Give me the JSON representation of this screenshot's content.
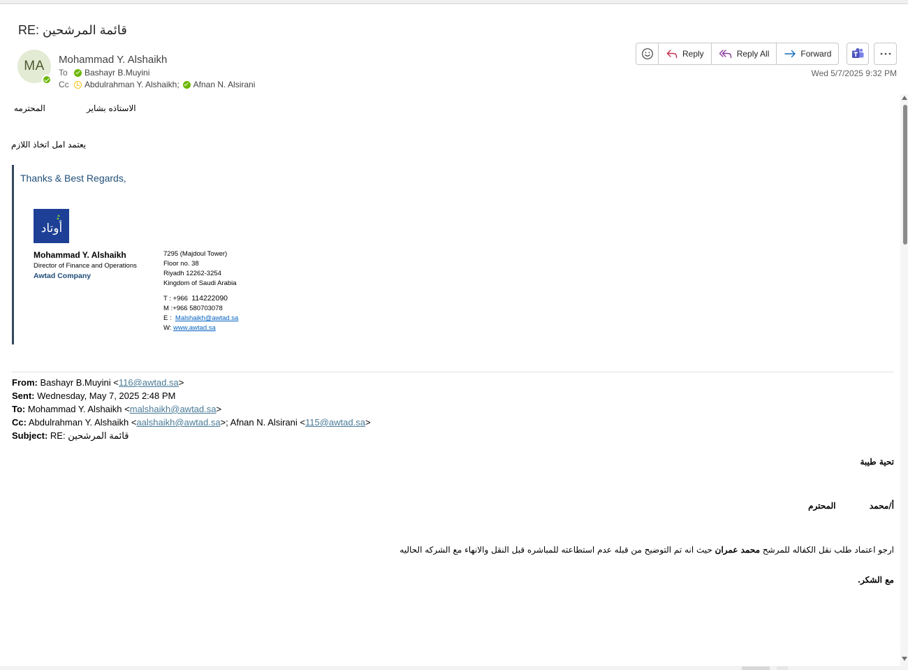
{
  "message": {
    "subject": "RE: قائمة المرشحين",
    "sender": {
      "initials": "MA",
      "name": "Mohammad Y. Alshaikh"
    },
    "to_label": "To",
    "cc_label": "Cc",
    "to": [
      {
        "name": "Bashayr B.Muyini",
        "status": "available"
      }
    ],
    "cc": [
      {
        "name": "Abdulrahman Y. Alshaikh;",
        "status": "away"
      },
      {
        "name": "Afnan N. Alsirani",
        "status": "available"
      }
    ],
    "date": "Wed 5/7/2025 9:32 PM"
  },
  "actions": {
    "reply": "Reply",
    "reply_all": "Reply All",
    "forward": "Forward"
  },
  "icons": {
    "emoji": "emoji-icon",
    "reply": "reply-arrow-icon",
    "reply_all": "reply-all-arrow-icon",
    "forward": "forward-arrow-icon",
    "teams": "teams-icon",
    "more": "more-dots-icon"
  },
  "colors": {
    "accent": "#0f6cbd",
    "reply_icon": "#c4314b",
    "reply_all_icon": "#8b3a9b",
    "forward_icon": "#0f6cbd",
    "teams": "#5b5fc7",
    "presence_available": "#6bb700",
    "presence_away": "#f8c01d",
    "signature_blue": "#1f4e79",
    "logo_bg": "#1d3f95"
  },
  "reply": {
    "greeting_title": "الاستاذه بشاير",
    "greeting_honorific": "المحترمه",
    "body": "يعتمد امل اتخاذ اللازم"
  },
  "signature": {
    "thanks": "Thanks & Best Regards,",
    "logo_text": "أوتاد",
    "name": "Mohammad Y. Alshaikh",
    "title": "Director of Finance and Operations",
    "company": "Awtad Company",
    "address": [
      "7295 (Majdoul Tower)",
      "Floor no. 38",
      "Riyadh 12262-3254",
      "Kingdom of Saudi Arabia"
    ],
    "phone_label": "T : +966",
    "phone_number": "114222090",
    "mobile": "M :+966 580703078",
    "email_label": "E :",
    "email": "Malshaikh@awtad.sa",
    "web_label": "W:",
    "web": "www.awtad.sa"
  },
  "original": {
    "from_label": "From:",
    "from_name": "Bashayr B.Muyini <",
    "from_email": "116@awtad.sa",
    "from_close": ">",
    "sent_label": "Sent:",
    "sent_value": "Wednesday, May 7, 2025 2:48 PM",
    "to_label": "To:",
    "to_name": "Mohammad Y. Alshaikh <",
    "to_email": "malshaikh@awtad.sa",
    "to_close": ">",
    "cc_label": "Cc:",
    "cc_name1": "Abdulrahman Y. Alshaikh <",
    "cc_email1": "aalshaikh@awtad.sa",
    "cc_mid": ">; Afnan N. Alsirani <",
    "cc_email2": "115@awtad.sa",
    "cc_close": ">",
    "subject_label": "Subject:",
    "subject_value": "RE: قائمة المرشحين",
    "greeting": "تحية طيبة",
    "addressee": "أ/محمد",
    "addressee_honorific": "المحترم",
    "body_before": "ارجو اعتماد طلب نقل الكفاله للمرشح ",
    "body_name": "محمد عمران",
    "body_after": " حيث انه تم التوضيح من قبله عدم استطاعته للمباشره قبل النقل والانهاء مع الشركه الحاليه",
    "closing": "مع الشكر."
  }
}
